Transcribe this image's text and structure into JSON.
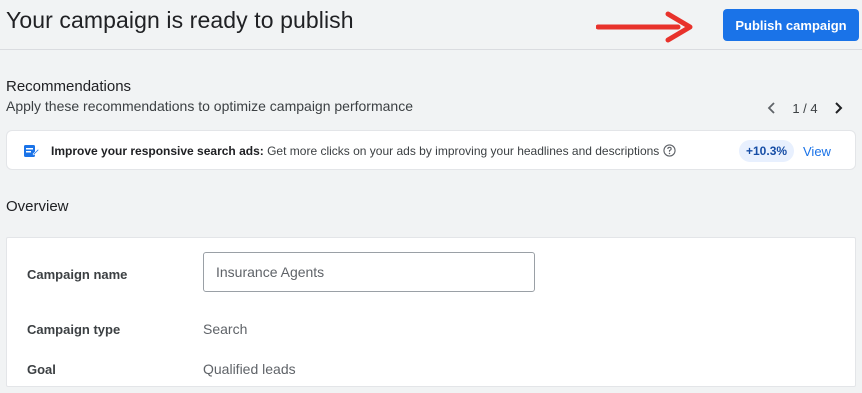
{
  "header": {
    "title": "Your campaign is ready to publish",
    "publish_label": "Publish campaign"
  },
  "recommendations": {
    "heading": "Recommendations",
    "subtitle": "Apply these recommendations to optimize campaign performance",
    "pager_text": "1 / 4",
    "card": {
      "title": "Improve your responsive search ads:",
      "description": " Get more clicks on your ads by improving your headlines and descriptions",
      "uplift": "+10.3%",
      "action_label": "View"
    }
  },
  "overview": {
    "heading": "Overview",
    "campaign_name_label": "Campaign name",
    "campaign_name_value": "Insurance Agents",
    "campaign_type_label": "Campaign type",
    "campaign_type_value": "Search",
    "goal_label": "Goal",
    "goal_value": "Qualified leads"
  },
  "colors": {
    "accent": "#1a73e8",
    "annotation_arrow": "#e8322b",
    "badge_bg": "#e8f0fe",
    "page_bg": "#f1f3f4"
  },
  "icons": [
    "arrow-annotation-icon",
    "chevron-left-icon",
    "chevron-right-icon",
    "ad-edit-icon",
    "help-icon"
  ]
}
